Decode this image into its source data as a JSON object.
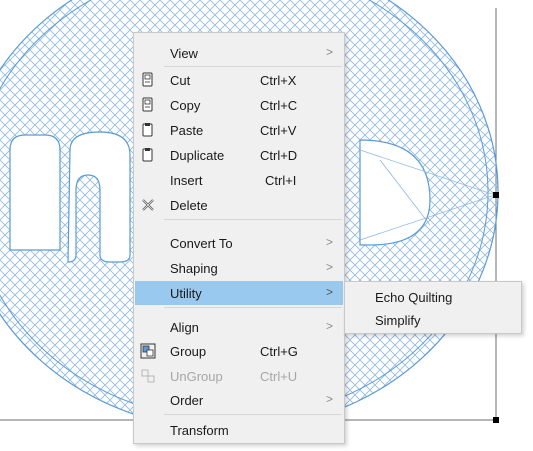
{
  "context_menu": {
    "items": [
      {
        "label": "View",
        "shortcut": "",
        "submenu": true,
        "icon": "",
        "disabled": false
      },
      {
        "label": "Cut",
        "shortcut": "Ctrl+X",
        "submenu": false,
        "icon": "cut-icon",
        "disabled": false
      },
      {
        "label": "Copy",
        "shortcut": "Ctrl+C",
        "submenu": false,
        "icon": "copy-icon",
        "disabled": false
      },
      {
        "label": "Paste",
        "shortcut": "Ctrl+V",
        "submenu": false,
        "icon": "paste-icon",
        "disabled": false
      },
      {
        "label": "Duplicate",
        "shortcut": "Ctrl+D",
        "submenu": false,
        "icon": "duplicate-icon",
        "disabled": false
      },
      {
        "label": "Insert",
        "shortcut": "Ctrl+I",
        "submenu": false,
        "icon": "",
        "disabled": false
      },
      {
        "label": "Delete",
        "shortcut": "",
        "submenu": false,
        "icon": "delete-icon",
        "disabled": false
      },
      {
        "label": "Convert To",
        "shortcut": "",
        "submenu": true,
        "icon": "",
        "disabled": false
      },
      {
        "label": "Shaping",
        "shortcut": "",
        "submenu": true,
        "icon": "",
        "disabled": false
      },
      {
        "label": "Utility",
        "shortcut": "",
        "submenu": true,
        "icon": "",
        "disabled": false,
        "highlighted": true
      },
      {
        "label": "Align",
        "shortcut": "",
        "submenu": true,
        "icon": "",
        "disabled": false
      },
      {
        "label": "Group",
        "shortcut": "Ctrl+G",
        "submenu": false,
        "icon": "group-icon",
        "disabled": false
      },
      {
        "label": "UnGroup",
        "shortcut": "Ctrl+U",
        "submenu": false,
        "icon": "ungroup-icon",
        "disabled": true
      },
      {
        "label": "Order",
        "shortcut": "",
        "submenu": true,
        "icon": "",
        "disabled": false
      },
      {
        "label": "Transform",
        "shortcut": "",
        "submenu": false,
        "icon": "",
        "disabled": false
      }
    ],
    "arrow_glyph": ">"
  },
  "utility_submenu": {
    "items": [
      {
        "label": "Echo Quilting"
      },
      {
        "label": "Simplify"
      }
    ]
  },
  "colors": {
    "highlight": "#99c9ef",
    "menu_background": "#f0f0f0",
    "drawing_stroke": "#5b9bd5",
    "disabled_text": "#a6a6a6"
  }
}
